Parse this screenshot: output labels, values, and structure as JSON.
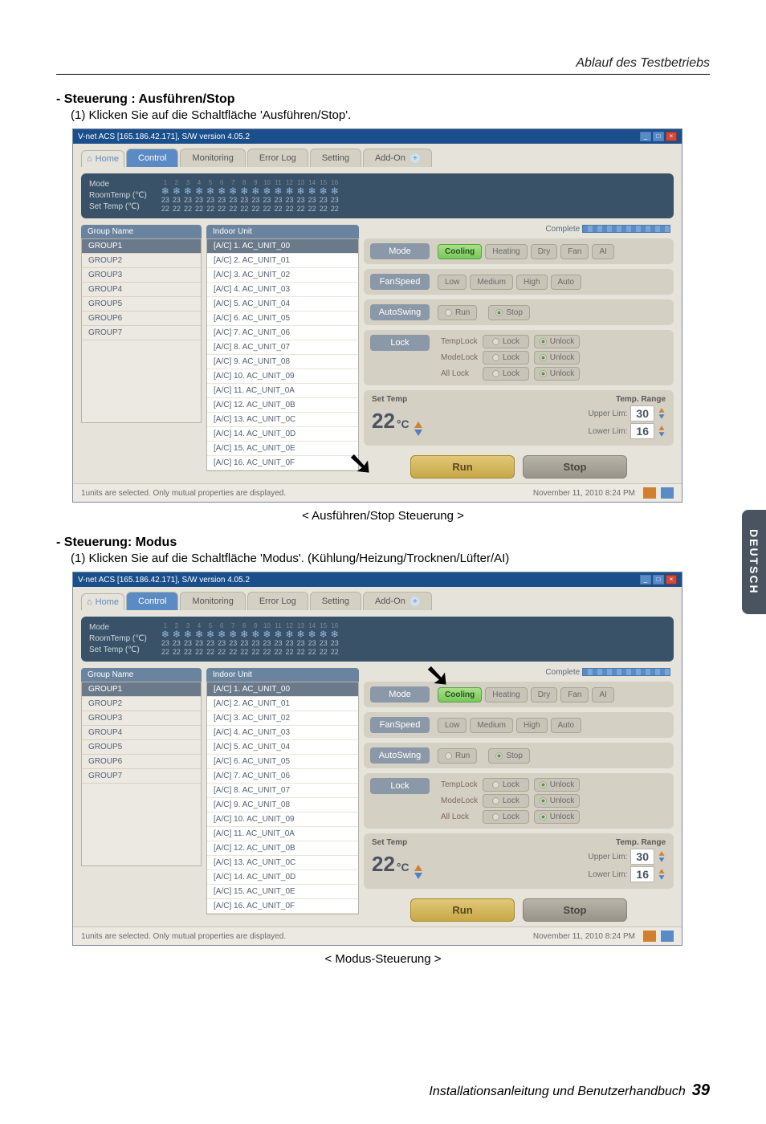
{
  "header": {
    "right": "Ablauf des Testbetriebs"
  },
  "sec1": {
    "title": "- Steuerung : Ausführen/Stop",
    "sub": "(1) Klicken Sie auf die Schaltfläche 'Ausführen/Stop'.",
    "caption": "< Ausführen/Stop Steuerung >"
  },
  "sec2": {
    "title": "- Steuerung: Modus",
    "sub": "(1) Klicken Sie auf die Schaltfläche 'Modus'. (Kühlung/Heizung/Trocknen/Lüfter/AI)",
    "caption": "< Modus-Steuerung >"
  },
  "app": {
    "title": "V-net ACS [165.186.42.171],   S/W version 4.05.2",
    "tabs": {
      "home": "Home",
      "control": "Control",
      "monitoring": "Monitoring",
      "errorlog": "Error Log",
      "setting": "Setting",
      "addon": "Add-On"
    },
    "strip": {
      "l1": "Mode",
      "l2": "RoomTemp (℃)",
      "l3": "Set Temp   (℃)",
      "cols": [
        "1",
        "2",
        "3",
        "4",
        "5",
        "6",
        "7",
        "8",
        "9",
        "10",
        "11",
        "12",
        "13",
        "14",
        "15",
        "16"
      ],
      "room": "23",
      "set": "22"
    },
    "group_head": "Group Name",
    "groups": [
      "GROUP1",
      "GROUP2",
      "GROUP3",
      "GROUP4",
      "GROUP5",
      "GROUP6",
      "GROUP7"
    ],
    "unit_head": "Indoor Unit",
    "units": [
      "[A/C] 1. AC_UNIT_00",
      "[A/C] 2. AC_UNIT_01",
      "[A/C] 3. AC_UNIT_02",
      "[A/C] 4. AC_UNIT_03",
      "[A/C] 5. AC_UNIT_04",
      "[A/C] 6. AC_UNIT_05",
      "[A/C] 7. AC_UNIT_06",
      "[A/C] 8. AC_UNIT_07",
      "[A/C] 9. AC_UNIT_08",
      "[A/C] 10. AC_UNIT_09",
      "[A/C] 11. AC_UNIT_0A",
      "[A/C] 12. AC_UNIT_0B",
      "[A/C] 13. AC_UNIT_0C",
      "[A/C] 14. AC_UNIT_0D",
      "[A/C] 15. AC_UNIT_0E",
      "[A/C] 16. AC_UNIT_0F"
    ],
    "complete": "Complete",
    "ctrl": {
      "mode": {
        "label": "Mode",
        "opts": [
          "Cooling",
          "Heating",
          "Dry",
          "Fan",
          "AI"
        ]
      },
      "fan": {
        "label": "FanSpeed",
        "opts": [
          "Low",
          "Medium",
          "High",
          "Auto"
        ]
      },
      "swing": {
        "label": "AutoSwing",
        "run": "Run",
        "stop": "Stop"
      },
      "lock": {
        "label": "Lock",
        "rows": [
          {
            "name": "TempLock",
            "a": "Lock",
            "b": "Unlock"
          },
          {
            "name": "ModeLock",
            "a": "Lock",
            "b": "Unlock"
          },
          {
            "name": "All Lock",
            "a": "Lock",
            "b": "Unlock"
          }
        ]
      },
      "temp": {
        "set_label": "Set Temp",
        "range_label": "Temp. Range",
        "value": "22",
        "unit": "°C",
        "upper_lbl": "Upper Lim:",
        "upper": "30",
        "lower_lbl": "Lower Lim:",
        "lower": "16"
      },
      "run": "Run",
      "stop": "Stop"
    },
    "status": {
      "left": "1units are selected. Only mutual properties are displayed.",
      "right": "November 11, 2010  8:24 PM"
    }
  },
  "side_tab": "DEUTSCH",
  "footer": {
    "text": "Installationsanleitung und Benutzerhandbuch",
    "page": "39"
  }
}
